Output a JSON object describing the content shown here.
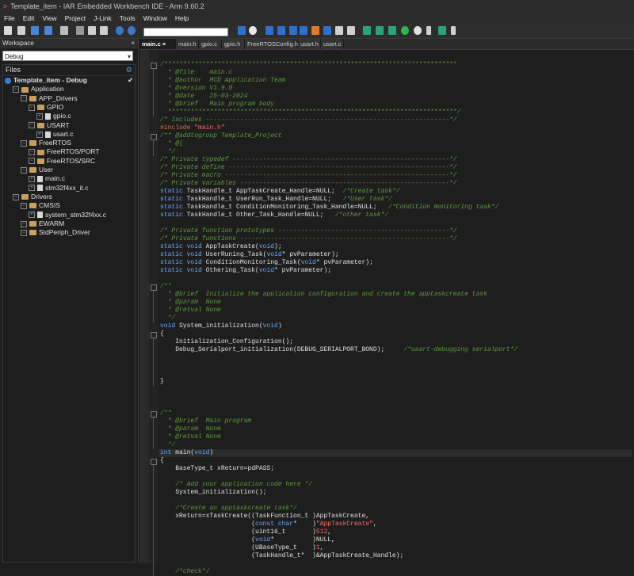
{
  "window": {
    "title": "Template_item - IAR Embedded Workbench IDE - Arm 9.60.2"
  },
  "menu": [
    "File",
    "Edit",
    "View",
    "Project",
    "J-Link",
    "Tools",
    "Window",
    "Help"
  ],
  "workspace": {
    "title": "Workspace",
    "config": "Debug",
    "files_header": "Files",
    "tree": [
      {
        "label": "Template_item - Debug",
        "level": 0,
        "type": "project"
      },
      {
        "label": "Application",
        "level": 1,
        "type": "folder"
      },
      {
        "label": "APP_Drivers",
        "level": 2,
        "type": "folder"
      },
      {
        "label": "GPIO",
        "level": 3,
        "type": "folder"
      },
      {
        "label": "gpio.c",
        "level": 4,
        "type": "file"
      },
      {
        "label": "USART",
        "level": 3,
        "type": "folder"
      },
      {
        "label": "usart.c",
        "level": 4,
        "type": "file"
      },
      {
        "label": "FreeRTOS",
        "level": 2,
        "type": "folder"
      },
      {
        "label": "FreeRTOS/PORT",
        "level": 3,
        "type": "folder"
      },
      {
        "label": "FreeRTOS/SRC",
        "level": 3,
        "type": "folder"
      },
      {
        "label": "User",
        "level": 2,
        "type": "folder"
      },
      {
        "label": "main.c",
        "level": 3,
        "type": "file"
      },
      {
        "label": "stm32f4xx_it.c",
        "level": 3,
        "type": "file"
      },
      {
        "label": "Drivers",
        "level": 1,
        "type": "folder"
      },
      {
        "label": "CMSIS",
        "level": 2,
        "type": "folder"
      },
      {
        "label": "system_stm32f4xx.c",
        "level": 3,
        "type": "file"
      },
      {
        "label": "EWARM",
        "level": 2,
        "type": "folder"
      },
      {
        "label": "StdPeriph_Driver",
        "level": 2,
        "type": "folder"
      }
    ]
  },
  "tabs": [
    "main.c",
    "main.h",
    "gpio.c",
    "gpio.h",
    "FreeRTOSConfig.h",
    "usart.h",
    "usart.c"
  ],
  "active_tab": "main.c",
  "code": [
    "/*****************************************************************************",
    "  * @file    main.c",
    "  * @author  MCD Application Team",
    "  * @version V1.9.0",
    "  * @date    25-03-2024",
    "  * @brief   Main program body",
    "  ****************************************************************************/",
    "/* Includes ----------------------------------------------------------------*/",
    "#include \"main.h\"",
    "/** @addtogroup Template_Project",
    "  * @{",
    "  */",
    "/* Private typedef ---------------------------------------------------------*/",
    "/* Private define ----------------------------------------------------------*/",
    "/* Private macro -----------------------------------------------------------*/",
    "/* Private variables -------------------------------------------------------*/",
    "static TaskHandle_t AppTaskCreate_Handle=NULL;  /*Create task*/",
    "static TaskHandle_t UserRun_Task_Handle=NULL;   /*User task*/",
    "static TaskHandle_t ConditionMonitoring_Task_Handle=NULL;   /*Condition monitoring task*/",
    "static TaskHandle_t Other_Task_Handle=NULL;   /*other task*/",
    "",
    "/* Private function prototypes ---------------------------------------------*/",
    "/* Private functions -------------------------------------------------------*/",
    "static void AppTaskCreate(void);",
    "static void UserRuning_Task(void* pvParameter);",
    "static void ConditionMonitoring_Task(void* pvParameter);",
    "static void Othering_Task(void* pvParameter);",
    "",
    "/**",
    "  * @brief  Initialize the application configuration and create the apptaskcreate task",
    "  * @param  None",
    "  * @retval None",
    "  */",
    "void System_initialization(void)",
    "{",
    "    Initialization_Configuration();",
    "    Debug_Serialport_initialization(DEBUG_SERIALPORT_BOND);     /*usart-debugging serialport*/",
    "",
    "",
    "",
    "}",
    "",
    "",
    "",
    "/**",
    "  * @brief  Main program",
    "  * @param  None",
    "  * @retval None",
    "  */",
    "int main(void)",
    "{",
    "    BaseType_t xReturn=pdPASS;",
    "",
    "    /* Add your application code here */",
    "    System_initialization();",
    "",
    "    /*Create an apptaskcreate task*/",
    "    xReturn=xTaskCreate((TaskFunction_t )AppTaskCreate,",
    "                        (const char*    )\"AppTaskCreate\",",
    "                        (uint16_t       )512,",
    "                        (void*          )NULL,",
    "                        (UBaseType_t    )1,",
    "                        (TaskHandle_t*  )&AppTaskCreate_Handle);",
    "",
    "    /*check*/"
  ]
}
